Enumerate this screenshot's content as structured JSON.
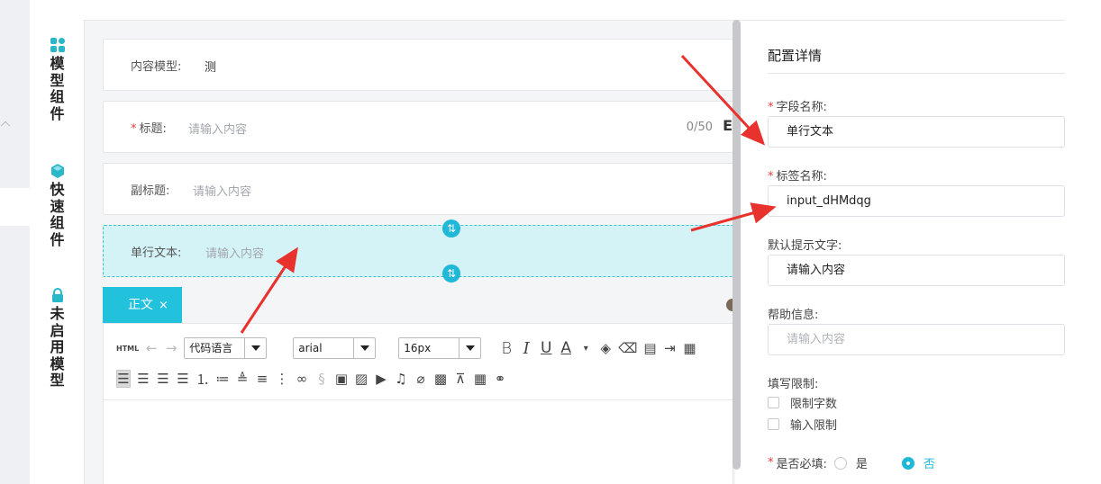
{
  "sidebar": {
    "groups": [
      {
        "label": "模型组件",
        "icon": "grid-icon"
      },
      {
        "label": "快速组件",
        "icon": "cube-icon"
      },
      {
        "label": "未启用模型",
        "icon": "lock-icon"
      }
    ]
  },
  "form": {
    "content_model_label": "内容模型:",
    "content_model_value": "测",
    "title_label": "标题:",
    "title_placeholder": "请输入内容",
    "title_counter": "0/50",
    "title_truncated": "E",
    "subtitle_label": "副标题:",
    "subtitle_placeholder": "请输入内容",
    "single_text_label": "单行文本:",
    "single_text_placeholder": "请输入内容"
  },
  "editor": {
    "tab_label": "正文",
    "tab_close": "×",
    "html_label": "HTML",
    "code_language": "代码语言",
    "font_family": "arial",
    "font_size": "16px",
    "bold": "B",
    "italic": "I",
    "underline": "U",
    "font_color": "A"
  },
  "panel": {
    "title": "配置详情",
    "field_name_label": "字段名称:",
    "field_name_value": "单行文本",
    "tag_name_label": "标签名称:",
    "tag_name_value": "input_dHMdqg",
    "default_hint_label": "默认提示文字:",
    "default_hint_value": "请输入内容",
    "help_label": "帮助信息:",
    "help_placeholder": "请输入内容",
    "limit_label": "填写限制:",
    "limit_chars": "限制字数",
    "limit_input": "输入限制",
    "required_label": "是否必填:",
    "required_yes": "是",
    "required_no": "否",
    "required_selected": "否"
  },
  "colors": {
    "accent": "#22c1dc",
    "active_field_bg": "#d4f3f6",
    "annotation_arrow": "#e8322e"
  }
}
